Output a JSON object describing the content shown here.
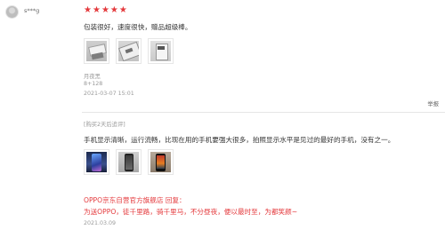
{
  "user": {
    "name": "s***g",
    "avatar_icon": "user-avatar-icon"
  },
  "rating": {
    "stars": 5,
    "max": 5,
    "color": "#e4393c"
  },
  "review": {
    "text": "包装很好，速度很快，赠品超级棒。",
    "images_count": 3,
    "variant": "月夜黑",
    "spec": "8+128",
    "timestamp": "2021-03-07 15:01",
    "report_label": "举报"
  },
  "followup": {
    "tag": "[购买2天后追评]",
    "text": "手机显示清晰，运行流畅，比现在用的手机要强大很多，拍照显示水平是见过的最好的手机，没有之一。",
    "images_count": 3
  },
  "seller_reply": {
    "title": "OPPO京东自营官方旗舰店 回复：",
    "text": "为送OPPO，徒千里路，骑千里马，不分昼夜，便以最时至，为都笑颜~",
    "date": "2021.03.09"
  }
}
